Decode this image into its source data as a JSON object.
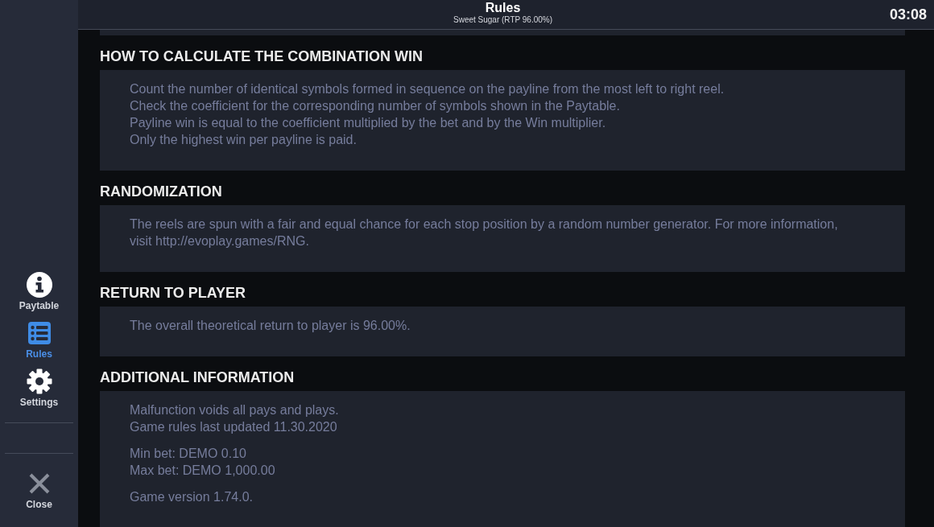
{
  "header": {
    "title": "Rules",
    "subtitle": "Sweet Sugar (RTP 96.00%)",
    "clock": "03:08"
  },
  "sidebar": {
    "items": [
      {
        "label": "Paytable",
        "selected": false
      },
      {
        "label": "Rules",
        "selected": true
      },
      {
        "label": "Settings",
        "selected": false
      }
    ],
    "close": {
      "label": "Close"
    }
  },
  "sections": [
    {
      "heading": "HOW TO CALCULATE THE COMBINATION WIN",
      "paragraphs": [
        [
          "Count the number of identical symbols formed in sequence on the payline from the most left to right reel.",
          "Check the coefficient for the corresponding number of symbols shown in the Paytable.",
          "Payline win is equal to the coefficient multiplied by the bet and by the Win multiplier.",
          "Only the highest win per payline is paid."
        ]
      ]
    },
    {
      "heading": "RANDOMIZATION",
      "paragraphs": [
        [
          "The reels are spun with a fair and equal chance for each stop position by a random number generator. For more information, visit http://evoplay.games/RNG."
        ]
      ]
    },
    {
      "heading": "RETURN TO PLAYER",
      "paragraphs": [
        [
          "The overall theoretical return to player is 96.00%."
        ]
      ]
    },
    {
      "heading": "ADDITIONAL INFORMATION",
      "paragraphs": [
        [
          "Malfunction voids all pays and plays.",
          "Game rules last updated 11.30.2020"
        ],
        [
          "Min bet: DEMO 0.10",
          "Max bet: DEMO 1,000.00"
        ],
        [
          "Game version 1.74.0."
        ]
      ]
    }
  ]
}
